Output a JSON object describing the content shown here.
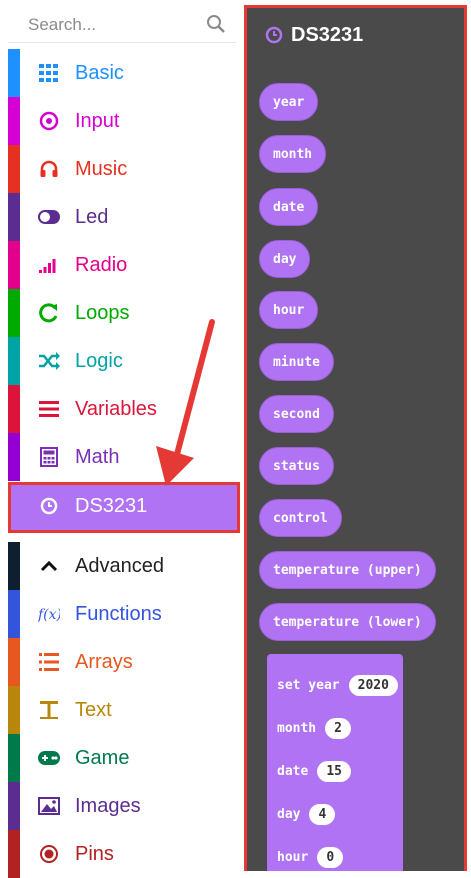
{
  "search": {
    "placeholder": "Search..."
  },
  "categories": [
    {
      "id": "basic",
      "label": "Basic",
      "color": "#1e90ff",
      "icon": "grid-icon"
    },
    {
      "id": "input",
      "label": "Input",
      "color": "#d400d4",
      "icon": "target-icon"
    },
    {
      "id": "music",
      "label": "Music",
      "color": "#e63022",
      "icon": "headphones-icon"
    },
    {
      "id": "led",
      "label": "Led",
      "color": "#5c2d91",
      "icon": "toggle-icon"
    },
    {
      "id": "radio",
      "label": "Radio",
      "color": "#e3008c",
      "icon": "signal-bars-icon"
    },
    {
      "id": "loops",
      "label": "Loops",
      "color": "#00aa00",
      "icon": "refresh-icon"
    },
    {
      "id": "logic",
      "label": "Logic",
      "color": "#00a4a6",
      "icon": "shuffle-icon"
    },
    {
      "id": "variables",
      "label": "Variables",
      "color": "#dc143c",
      "icon": "lines-icon"
    },
    {
      "id": "math",
      "label": "Math",
      "color": "#9400d3",
      "icon": "calculator-icon"
    },
    {
      "id": "ds3231",
      "label": "DS3231",
      "color": "#b073f3",
      "icon": "clock-icon"
    },
    {
      "id": "advanced",
      "label": "Advanced",
      "color": "#0f1f2f",
      "icon": "chevron-up-icon"
    },
    {
      "id": "functions",
      "label": "Functions",
      "color": "#3455db",
      "icon": "function-icon"
    },
    {
      "id": "arrays",
      "label": "Arrays",
      "color": "#e65722",
      "icon": "list-icon"
    },
    {
      "id": "text",
      "label": "Text",
      "color": "#b8860b",
      "icon": "text-icon"
    },
    {
      "id": "game",
      "label": "Game",
      "color": "#007a4b",
      "icon": "gamepad-icon"
    },
    {
      "id": "images",
      "label": "Images",
      "color": "#5c2d91",
      "icon": "image-icon"
    },
    {
      "id": "pins",
      "label": "Pins",
      "color": "#b22222",
      "icon": "pin-icon"
    }
  ],
  "flyout": {
    "title": "DS3231",
    "reporters": [
      "year",
      "month",
      "date",
      "day",
      "hour",
      "minute",
      "second",
      "status",
      "control",
      "temperature (upper)",
      "temperature (lower)"
    ],
    "set_block": {
      "rows": [
        {
          "label": "set year",
          "value": "2020"
        },
        {
          "label": "month",
          "value": "2"
        },
        {
          "label": "date",
          "value": "15"
        },
        {
          "label": "day",
          "value": "4"
        },
        {
          "label": "hour",
          "value": "0"
        }
      ]
    }
  }
}
